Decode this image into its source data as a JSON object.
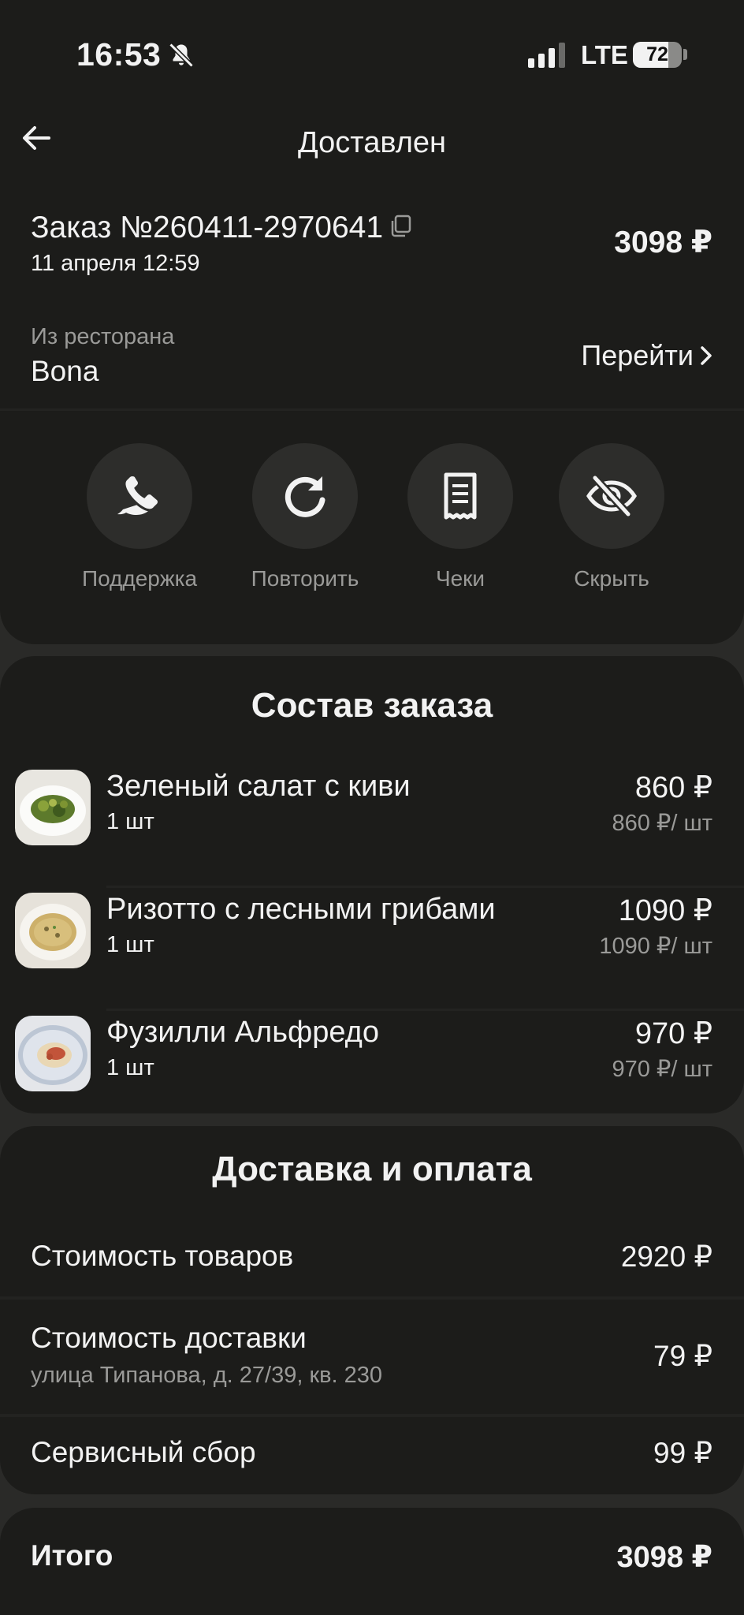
{
  "status_bar": {
    "time": "16:53",
    "network": "LTE",
    "battery": "72",
    "battery_level": 0.72
  },
  "header": {
    "title": "Доставлен"
  },
  "order": {
    "number": "Заказ №260411-2970641",
    "date": "11 апреля 12:59",
    "total": "3098 ₽",
    "from_label": "Из ресторана",
    "restaurant": "Bona",
    "go_link": "Перейти"
  },
  "actions": [
    {
      "label": "Поддержка",
      "icon": "phone-chat-icon"
    },
    {
      "label": "Повторить",
      "icon": "repeat-icon"
    },
    {
      "label": "Чеки",
      "icon": "receipt-icon"
    },
    {
      "label": "Скрыть",
      "icon": "eye-off-icon"
    }
  ],
  "items_section": {
    "title": "Состав заказа",
    "items": [
      {
        "name": "Зеленый салат с киви",
        "qty": "1 шт",
        "price": "860 ₽",
        "unit_price": "860 ₽/ шт",
        "image": "salad-thumbnail"
      },
      {
        "name": "Ризотто с лесными грибами",
        "qty": "1 шт",
        "price": "1090 ₽",
        "unit_price": "1090 ₽/ шт",
        "image": "risotto-thumbnail"
      },
      {
        "name": "Фузилли Альфредо",
        "qty": "1 шт",
        "price": "970 ₽",
        "unit_price": "970 ₽/ шт",
        "image": "pasta-thumbnail"
      }
    ]
  },
  "payment_section": {
    "title": "Доставка и оплата",
    "goods_label": "Стоимость товаров",
    "goods_value": "2920 ₽",
    "delivery_label": "Стоимость доставки",
    "delivery_address": "улица Типанова, д. 27/39, кв. 230",
    "delivery_value": "79 ₽",
    "service_label": "Сервисный сбор",
    "service_value": "99 ₽"
  },
  "total": {
    "label": "Итого",
    "value": "3098 ₽"
  },
  "colors": {
    "background": "#1c1c1a",
    "panel_gap": "#2a2a28",
    "text": "#f2f2f2",
    "muted_text": "#9a9a98",
    "action_circle": "#2d2d2b"
  }
}
